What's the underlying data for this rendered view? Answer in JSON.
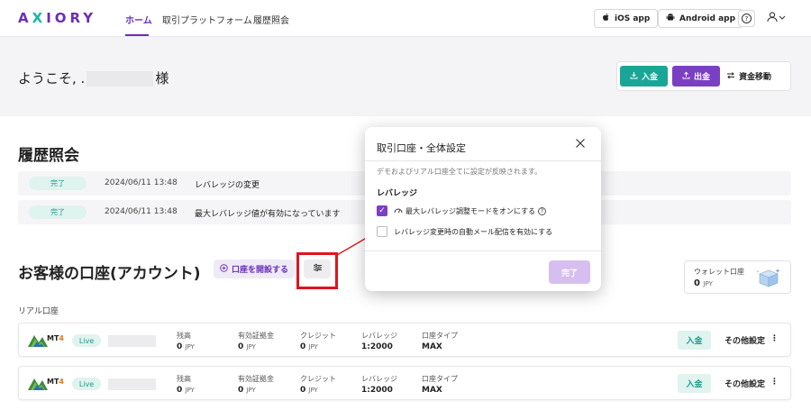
{
  "header": {
    "logo_a": "A",
    "logo_x": "X",
    "logo_rest": "IORY",
    "nav": [
      {
        "label": "ホーム",
        "active": true
      },
      {
        "label": "取引プラットフォーム",
        "active": false
      },
      {
        "label": "履歴照会",
        "active": false
      }
    ],
    "ios_label": "iOS app",
    "android_label": "Android app",
    "help_glyph": "?"
  },
  "welcome": {
    "prefix": "ようこそ, .",
    "suffix": "様"
  },
  "funds": {
    "deposit": "入金",
    "withdraw": "出金",
    "transfer": "資金移動"
  },
  "history": {
    "title": "履歴照会",
    "rows": [
      {
        "status": "完了",
        "date": "2024/06/11 13:48",
        "text": "レバレッジの変更"
      },
      {
        "status": "完了",
        "date": "2024/06/11 13:48",
        "text": "最大レバレッジ値が有効になっています"
      }
    ]
  },
  "accounts": {
    "title": "お客様の口座(アカウント)",
    "open_button": "口座を開設する",
    "settings_glyph": "☷",
    "wallet": {
      "label": "ウォレット口座",
      "value": "0",
      "unit": "JPY"
    },
    "real_label": "リアル口座",
    "rows": [
      {
        "platform": "MT",
        "platform_num": "4",
        "badge": "Live",
        "balance_label": "残高",
        "balance": "0",
        "unit": "JPY",
        "margin_label": "有効証拠金",
        "margin": "0",
        "credit_label": "クレジット",
        "credit": "0",
        "leverage_label": "レバレッジ",
        "leverage": "1:2000",
        "type_label": "口座タイプ",
        "type": "MAX",
        "deposit": "入金",
        "more": "その他設定"
      },
      {
        "platform": "MT",
        "platform_num": "4",
        "badge": "Live",
        "balance_label": "残高",
        "balance": "0",
        "unit": "JPY",
        "margin_label": "有効証拠金",
        "margin": "0",
        "credit_label": "クレジット",
        "credit": "0",
        "leverage_label": "レバレッジ",
        "leverage": "1:2000",
        "type_label": "口座タイプ",
        "type": "MAX",
        "deposit": "入金",
        "more": "その他設定"
      }
    ]
  },
  "modal": {
    "title": "取引口座・全体設定",
    "description": "デモおよびリアル口座全てに設定が反映されます。",
    "section": "レバレッジ",
    "option1": "最大レバレッジ調整モードをオンにする",
    "option1_checked": true,
    "option2": "レバレッジ変更時の自動メール配信を有効にする",
    "option2_checked": false,
    "done": "完了"
  },
  "colors": {
    "brand": "#6a2fb5",
    "teal": "#1aa697",
    "highlight": "#e0141e"
  }
}
